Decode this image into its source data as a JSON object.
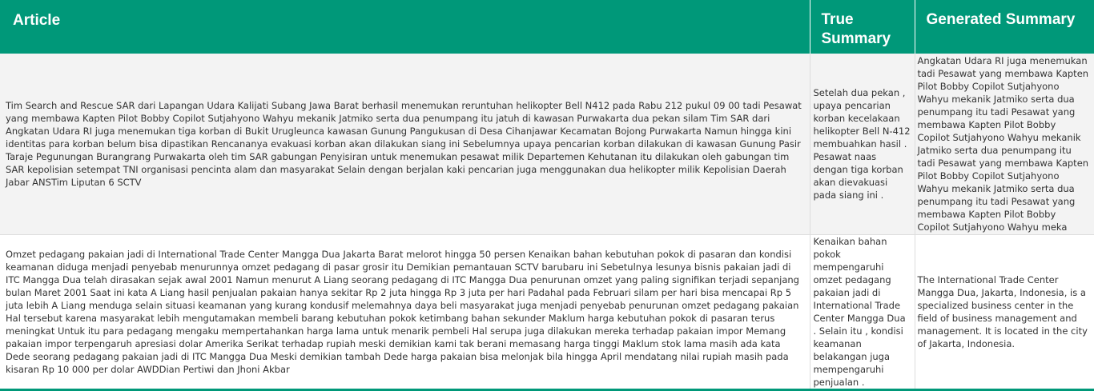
{
  "table": {
    "headers": {
      "article": "Article",
      "true_summary": "True Summary",
      "generated_summary": "Generated Summary"
    },
    "rows": [
      {
        "article": "Tim Search and Rescue SAR dari Lapangan Udara Kalijati Subang Jawa Barat berhasil menemukan reruntuhan helikopter Bell N412 pada Rabu 212 pukul 09 00 tadi Pesawat yang membawa Kapten Pilot Bobby Copilot Sutjahyono Wahyu mekanik Jatmiko serta dua penumpang itu jatuh di kawasan Purwakarta dua pekan silam Tim SAR dari Angkatan Udara RI juga menemukan tiga korban di Bukit Urugleunca kawasan Gunung Pangukusan di Desa Cihanjawar Kecamatan Bojong Purwakarta Namun hingga kini identitas para korban belum bisa dipastikan Rencananya evakuasi korban akan dilakukan siang ini Sebelumnya upaya pencarian korban dilakukan di kawasan Gunung Pasir Taraje Pegunungan Burangrang Purwakarta oleh tim SAR gabungan Penyisiran untuk menemukan pesawat milik Departemen Kehutanan itu dilakukan oleh gabungan tim SAR kepolisian setempat TNI organisasi pencinta alam dan masyarakat Selain dengan berjalan kaki pencarian juga menggunakan dua helikopter milik Kepolisian Daerah Jabar ANSTim Liputan 6 SCTV",
        "true_summary": "Setelah dua pekan , upaya pencarian korban kecelakaan helikopter Bell N-412 membuahkan hasil . Pesawat naas dengan tiga korban akan dievakuasi pada siang ini .",
        "generated_summary": "Angkatan Udara RI juga menemukan tadi Pesawat yang membawa Kapten Pilot Bobby Copilot Sutjahyono Wahyu mekanik Jatmiko serta dua penumpang itu tadi Pesawat yang membawa Kapten Pilot Bobby Copilot Sutjahyono Wahyu mekanik Jatmiko serta dua penumpang itu tadi Pesawat yang membawa Kapten Pilot Bobby Copilot Sutjahyono Wahyu mekanik Jatmiko serta dua penumpang itu tadi Pesawat yang membawa Kapten Pilot Bobby Copilot Sutjahyono Wahyu meka"
      },
      {
        "article": "Omzet pedagang pakaian jadi di International Trade Center Mangga Dua Jakarta Barat melorot hingga 50 persen Kenaikan bahan kebutuhan pokok di pasaran dan kondisi keamanan diduga menjadi penyebab menurunnya omzet pedagang di pasar grosir itu Demikian pemantauan SCTV barubaru ini Sebetulnya lesunya bisnis pakaian jadi di ITC Mangga Dua telah dirasakan sejak awal 2001 Namun menurut A Liang seorang pedagang di ITC Mangga Dua penurunan omzet yang paling signifikan terjadi sepanjang bulan Maret 2001 Saat ini kata A Liang hasil penjualan pakaian hanya sekitar Rp 2 juta hingga Rp 3 juta per hari Padahal pada Februari silam per hari bisa mencapai Rp 5 juta lebih A Liang menduga selain situasi keamanan yang kurang kondusif melemahnya daya beli masyarakat juga menjadi penyebab penurunan omzet pedagang pakaian Hal tersebut karena masyarakat lebih mengutamakan membeli barang kebutuhan pokok ketimbang bahan sekunder Maklum harga kebutuhan pokok di pasaran terus meningkat Untuk itu para pedagang mengaku mempertahankan harga lama untuk menarik pembeli Hal serupa juga dilakukan mereka terhadap pakaian impor Memang pakaian impor terpengaruh apresiasi dolar Amerika Serikat terhadap rupiah meski demikian kami tak berani memasang harga tinggi Maklum stok lama masih ada kata Dede seorang pedagang pakaian jadi di ITC Mangga Dua Meski demikian tambah Dede harga pakaian bisa melonjak bila hingga April mendatang nilai rupiah masih pada kisaran Rp 10 000 per dolar AWDDian Pertiwi dan Jhoni Akbar",
        "true_summary": "Kenaikan bahan pokok mempengaruhi omzet pedagang pakaian jadi di International Trade Center Mangga Dua . Selain itu , kondisi keamanan belakangan juga mempengaruhi penjualan .",
        "generated_summary": "The International Trade Center Mangga Dua, Jakarta, Indonesia, is a specialized business center in the field of business management and management. It is located in the city of Jakarta, Indonesia."
      }
    ]
  }
}
